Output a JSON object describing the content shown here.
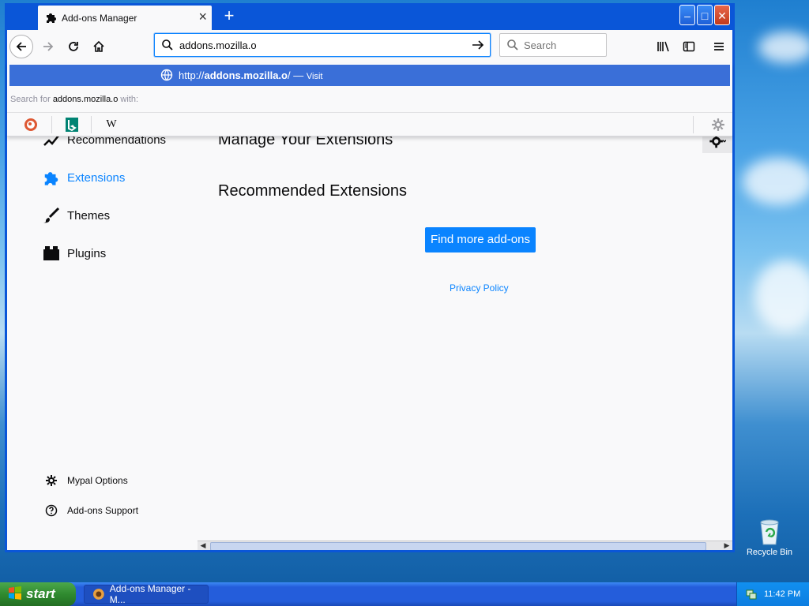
{
  "window": {
    "tab_title": "Add-ons Manager",
    "new_tab": "+",
    "minimize": "–",
    "maximize": "□",
    "close": "✕"
  },
  "navbar": {
    "url_value": "addons.mozilla.o",
    "search_placeholder": "Search"
  },
  "url_popup": {
    "suggestion_prefix": "http://",
    "suggestion_bold": "addons.mozilla.o",
    "suggestion_suffix": "/",
    "suggestion_sep": " — ",
    "suggestion_action": "Visit",
    "search_for_prefix": "Search for ",
    "search_for_term": "addons.mozilla.o",
    "search_for_suffix": " with:",
    "engines": [
      "duckduckgo-icon",
      "bing-icon",
      "wikipedia-icon"
    ],
    "wikipedia_glyph": "W"
  },
  "sidebar": {
    "items": [
      {
        "label": "Recommendations",
        "icon": "recommendations-icon"
      },
      {
        "label": "Extensions",
        "icon": "puzzle-icon",
        "active": true
      },
      {
        "label": "Themes",
        "icon": "brush-icon"
      },
      {
        "label": "Plugins",
        "icon": "plugin-icon"
      }
    ],
    "footer": [
      {
        "label": "Mypal Options",
        "icon": "gear-icon"
      },
      {
        "label": "Add-ons Support",
        "icon": "help-icon"
      }
    ]
  },
  "main": {
    "heading": "Manage Your Extensions",
    "recommended_heading": "Recommended Extensions",
    "find_button": "Find more add-ons",
    "privacy_link": "Privacy Policy"
  },
  "desktop": {
    "recycle_bin": "Recycle Bin"
  },
  "taskbar": {
    "start_label": "start",
    "task_label": "Add-ons Manager - M...",
    "clock": "11:42 PM"
  },
  "colors": {
    "accent": "#0a84ff",
    "titlebar": "#0a56d8",
    "suggestion_bg": "#3a6fd8",
    "start_green": "#2f8a2f"
  }
}
